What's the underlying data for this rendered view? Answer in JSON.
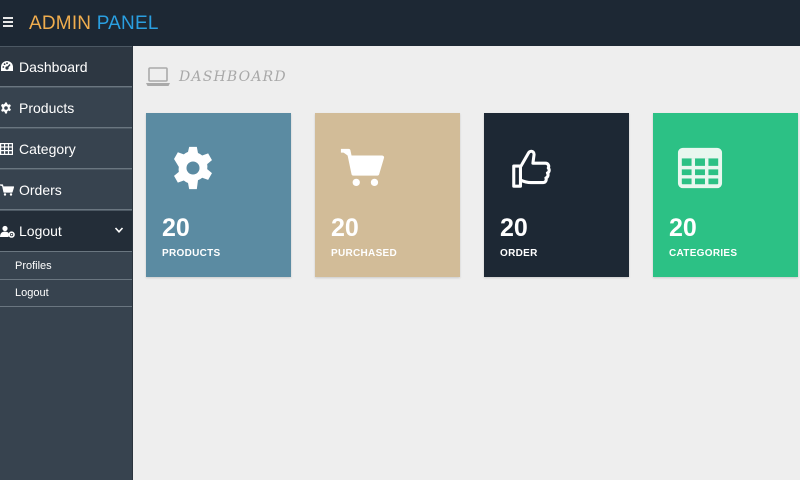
{
  "brand": {
    "part1": "ADMIN",
    "part2": "PANEL"
  },
  "sidebar": {
    "items": [
      {
        "label": "Dashboard",
        "icon": "dashboard-icon"
      },
      {
        "label": "Products",
        "icon": "gear-icon"
      },
      {
        "label": "Category",
        "icon": "table-icon"
      },
      {
        "label": "Orders",
        "icon": "cart-icon"
      },
      {
        "label": "Logout",
        "icon": "users-cog-icon"
      }
    ],
    "submenu": [
      {
        "label": "Profiles"
      },
      {
        "label": "Logout"
      }
    ]
  },
  "main": {
    "title": "DASHBOARD",
    "cards": [
      {
        "value": "20",
        "label": "PRODUCTS",
        "icon": "gear-icon",
        "color": "#5b8ba2"
      },
      {
        "value": "20",
        "label": "PURCHASED",
        "icon": "cart-icon",
        "color": "#d2bc98"
      },
      {
        "value": "20",
        "label": "ORDER",
        "icon": "thumbs-up-icon",
        "color": "#1d2834"
      },
      {
        "value": "20",
        "label": "CATEGORIES",
        "icon": "table-icon",
        "color": "#2cc185"
      }
    ]
  },
  "colors": {
    "topbar": "#1d2834",
    "sidebar": "#37434f",
    "accent_orange": "#f0ad4e",
    "accent_blue": "#2a9fe0"
  }
}
